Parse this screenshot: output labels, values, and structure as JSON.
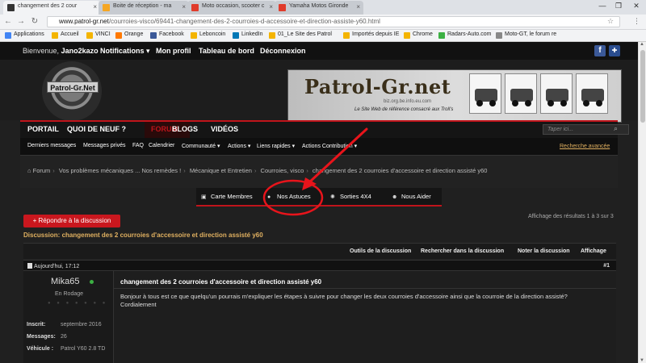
{
  "browser": {
    "tabs": [
      {
        "label": "changement des 2 cour",
        "icon_color": "#333333",
        "active": true
      },
      {
        "label": "Boite de réception - ma",
        "icon_color": "#f5a623",
        "active": false
      },
      {
        "label": "Moto occasion, scooter c",
        "icon_color": "#e03b2b",
        "active": false
      },
      {
        "label": "Yamaha Motos Gironde",
        "icon_color": "#e03b2b",
        "active": false
      }
    ],
    "window_controls": [
      "—",
      "❐",
      "✕"
    ],
    "url_domain": "www.patrol-gr.net",
    "url_path": "/courroies-visco/69441-changement-des-2-courroies-d-accessoire-et-direction-assiste-y60.html",
    "bookmarks": [
      {
        "label": "Applications",
        "color": "#4285f4"
      },
      {
        "label": "Accueil",
        "color": "#f4b400"
      },
      {
        "label": "VINCI",
        "color": "#f4b400"
      },
      {
        "label": "Orange",
        "color": "#ff7900"
      },
      {
        "label": "Facebook",
        "color": "#3b5998"
      },
      {
        "label": "Leboncoin",
        "color": "#f4b400"
      },
      {
        "label": "LinkedIn",
        "color": "#0077b5"
      },
      {
        "label": "01_Le Site des Patrol",
        "color": "#f4b400"
      },
      {
        "label": "Importés depuis IE",
        "color": "#f4b400"
      },
      {
        "label": "Chrome",
        "color": "#f4b400"
      },
      {
        "label": "Radars-Auto.com",
        "color": "#3cb043"
      },
      {
        "label": "Moto-GT, le forum re",
        "color": "#888888"
      }
    ]
  },
  "topbar": {
    "welcome": "Bienvenue,",
    "user": "Jano2kazo",
    "links": [
      "Notifications ▾",
      "Mon profil",
      "Tableau de bord",
      "Déconnexion"
    ],
    "social_fb": "f",
    "social_other": "✚"
  },
  "header": {
    "logo_text": "Patrol-Gr.Net",
    "banner_title": "Patrol-Gr.net",
    "banner_sub1": "biz.org.be.info.eu.com",
    "banner_sub2": "Le Site Web de référence consacré aux Troll's"
  },
  "nav": {
    "tabs": [
      "PORTAIL",
      "QUOI DE NEUF ?",
      "FORUM",
      "BLOGS",
      "VIDÉOS"
    ],
    "active": "FORUM",
    "search_placeholder": "Taper ici...",
    "subnav": [
      "Derniers messages",
      "Messages privés",
      "FAQ",
      "Calendrier",
      "Communauté ▾",
      "Actions ▾",
      "Liens rapides ▾",
      "Actions Contribution ▾"
    ],
    "advanced_search": "Recherche avancée"
  },
  "breadcrumb": {
    "home_icon": "⌂",
    "items": [
      "Forum",
      "Vos problèmes mécaniques ... Nos remèdes !",
      "Mécanique et Entretien",
      "Courroies, visco",
      "changement des 2 courroies d'accessoire et direction assisté y60"
    ]
  },
  "sections": [
    {
      "label": "Carte Membres",
      "icon": "▣"
    },
    {
      "label": "Nos Astuces",
      "icon": "●"
    },
    {
      "label": "Sorties 4X4",
      "icon": "✺"
    },
    {
      "label": "Nous Aider",
      "icon": "☻"
    }
  ],
  "thread": {
    "reply_button": "+ Répondre à la discussion",
    "results": "Affichage des résultats 1 à 3 sur 3",
    "discussion_label": "Discussion:",
    "discussion_title": "changement des 2 courroies d'accessoire et direction assisté y60",
    "tools": [
      "Outils de la discussion",
      "Rechercher dans la discussion",
      "Noter la discussion",
      "Affichage"
    ]
  },
  "post": {
    "date": "Aujourd'hui, 17:12",
    "number": "#1",
    "username": "Mika65",
    "rank": "En Rodage",
    "stars": "● ● ● ● ● ● ●",
    "stats": [
      {
        "k": "Inscrit:",
        "v": "septembre 2016"
      },
      {
        "k": "Messages:",
        "v": "26"
      },
      {
        "k": "Véhicule :",
        "v": "Patrol Y60 2.8 TD"
      }
    ],
    "title": "changement des 2 courroies d'accessoire et direction assisté y60",
    "body_line1": "Bonjour à tous est ce que quelqu'un pourrais m'expliquer les étapes à suivre pour changer les deux courroies d'accessoire ainsi que la courroie de la direction assisté?",
    "body_line2": "Cordialement"
  },
  "colors": {
    "accent_red": "#c0141b",
    "link_gold": "#e0b060",
    "annotation": "#e8141b"
  }
}
